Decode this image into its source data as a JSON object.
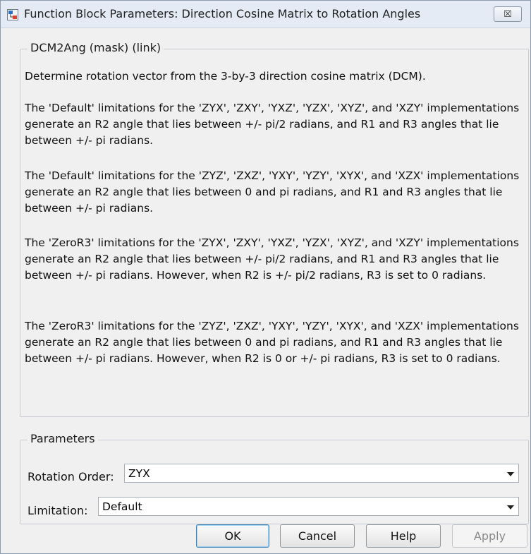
{
  "window": {
    "title": "Function Block Parameters: Direction Cosine Matrix to Rotation Angles",
    "close_label": "☒"
  },
  "description": {
    "group_label": "DCM2Ang (mask) (link)",
    "paragraphs": [
      "Determine rotation vector from the 3-by-3 direction cosine matrix (DCM).",
      "The 'Default' limitations for the 'ZYX', 'ZXY', 'YXZ', 'YZX', 'XYZ', and 'XZY' implementations generate an R2 angle that lies between +/- pi/2 radians, and R1 and R3 angles that lie between +/- pi radians.",
      "The 'Default' limitations for the 'ZYZ', 'ZXZ', 'YXY', 'YZY', 'XYX', and 'XZX' implementations generate an R2 angle that lies between 0 and pi radians, and R1 and R3 angles that lie between +/- pi radians.",
      "The 'ZeroR3' limitations for the 'ZYX', 'ZXY', 'YXZ', 'YZX', 'XYZ', and 'XZY' implementations generate an R2 angle that lies between +/- pi/2 radians, and R1 and R3 angles that lie between +/- pi radians. However, when R2 is +/- pi/2 radians, R3 is set to 0 radians.",
      "The 'ZeroR3' limitations for the 'ZYZ', 'ZXZ', 'YXY', 'YZY', 'XYX', and 'XZX' implementations generate an R2 angle that lies between 0 and pi radians, and R1 and R3 angles that lie between +/- pi radians. However, when R2 is 0 or +/- pi radians, R3 is set to 0 radians."
    ]
  },
  "parameters": {
    "group_label": "Parameters",
    "rotation_order": {
      "label": "Rotation Order:",
      "value": "ZYX"
    },
    "limitation": {
      "label": "Limitation:",
      "value": "Default"
    }
  },
  "buttons": {
    "ok": "OK",
    "cancel": "Cancel",
    "help": "Help",
    "apply": "Apply"
  }
}
